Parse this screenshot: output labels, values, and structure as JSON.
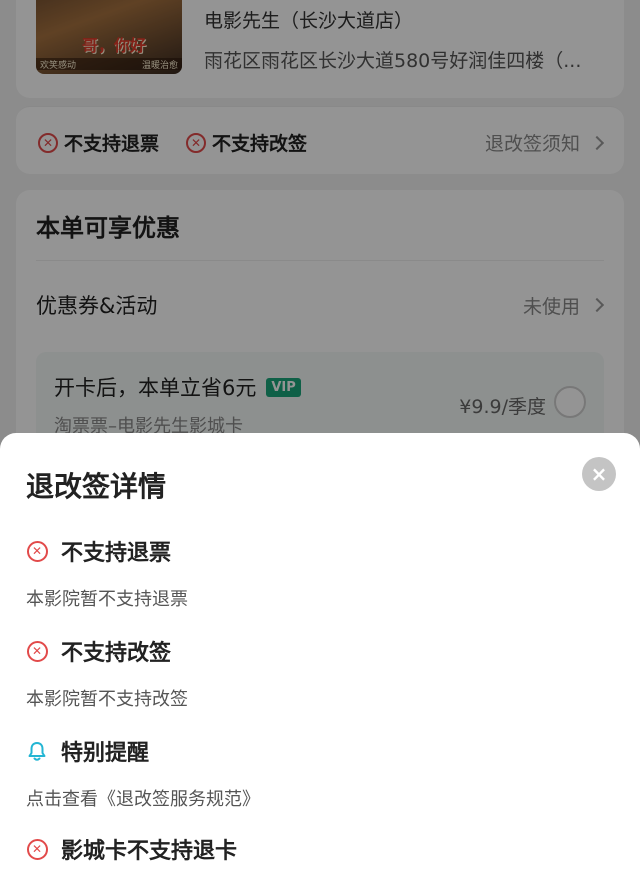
{
  "background": {
    "cinema": {
      "poster_title": "哥，你好",
      "poster_left_text": "欢笑感动",
      "poster_right_text": "温暖治愈",
      "name": "电影先生（长沙大道店）",
      "address": "雨花区雨花区长沙大道580号好润佳四楼（..."
    },
    "policy": {
      "no_refund": "不支持退票",
      "no_change": "不支持改签",
      "notice_link": "退改签须知"
    },
    "discount": {
      "title": "本单可享优惠",
      "coupon_label": "优惠券&活动",
      "coupon_value": "未使用",
      "vip_title": "开卡后，本单立省6元",
      "vip_badge": "VIP",
      "vip_sub": "淘票票–电影先生影城卡",
      "vip_price": "¥9.9/季度"
    }
  },
  "sheet": {
    "title": "退改签详情",
    "close_icon": "×",
    "rules": [
      {
        "icon": "x-circle-icon",
        "title": "不支持退票",
        "desc": "本影院暂不支持退票"
      },
      {
        "icon": "x-circle-icon",
        "title": "不支持改签",
        "desc": "本影院暂不支持改签"
      },
      {
        "icon": "bell-icon",
        "title": "特别提醒",
        "desc": "点击查看《退改签服务规范》"
      },
      {
        "icon": "x-circle-icon",
        "title": "影城卡不支持退卡",
        "desc": ""
      }
    ]
  },
  "colors": {
    "error_red": "#e24a4a",
    "bell_cyan": "#23b5d3",
    "vip_green": "#1aa57a"
  }
}
